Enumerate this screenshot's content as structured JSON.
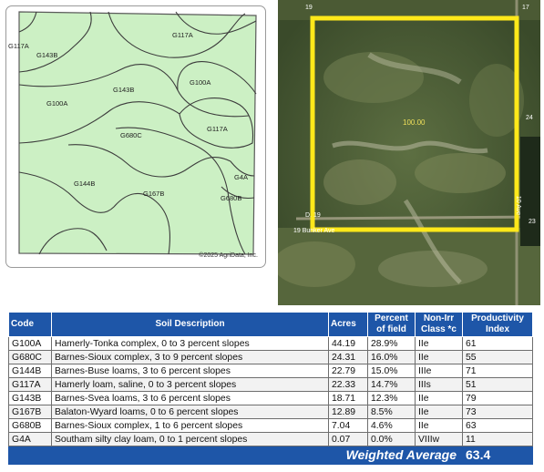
{
  "soil_map": {
    "labels": [
      "G117A",
      "G143B",
      "G117A",
      "G100A",
      "G143B",
      "G100A",
      "G117A",
      "G680C",
      "G4A",
      "G144B",
      "G167B",
      "G680B"
    ],
    "copyright": "©2025 AgriData, Inc."
  },
  "aerial": {
    "field_acres": "100.00",
    "corner_top_left": "19",
    "corner_top_right": "17",
    "bottom_left_text": "D. 19",
    "bottom_road": "19 Bunker Ave",
    "right_road": "10 Ave",
    "right_mark": "24",
    "right_mark_2": "23"
  },
  "table": {
    "headers": {
      "code": "Code",
      "description": "Soil Description",
      "acres": "Acres",
      "percent": "Percent of field",
      "class": "Non-Irr Class *c",
      "productivity": "Productivity Index"
    },
    "rows": [
      {
        "code": "G100A",
        "description": "Hamerly-Tonka complex, 0 to 3 percent slopes",
        "acres": "44.19",
        "percent": "28.9%",
        "class": "IIe",
        "pi": "61"
      },
      {
        "code": "G680C",
        "description": "Barnes-Sioux complex, 3 to 9 percent slopes",
        "acres": "24.31",
        "percent": "16.0%",
        "class": "IIe",
        "pi": "55"
      },
      {
        "code": "G144B",
        "description": "Barnes-Buse loams, 3 to 6 percent slopes",
        "acres": "22.79",
        "percent": "15.0%",
        "class": "IIIe",
        "pi": "71"
      },
      {
        "code": "G117A",
        "description": "Hamerly loam, saline, 0 to 3 percent slopes",
        "acres": "22.33",
        "percent": "14.7%",
        "class": "IIIs",
        "pi": "51"
      },
      {
        "code": "G143B",
        "description": "Barnes-Svea loams, 3 to 6 percent slopes",
        "acres": "18.71",
        "percent": "12.3%",
        "class": "IIe",
        "pi": "79"
      },
      {
        "code": "G167B",
        "description": "Balaton-Wyard loams, 0 to 6 percent slopes",
        "acres": "12.89",
        "percent": "8.5%",
        "class": "IIe",
        "pi": "73"
      },
      {
        "code": "G680B",
        "description": "Barnes-Sioux complex, 1 to 6 percent slopes",
        "acres": "7.04",
        "percent": "4.6%",
        "class": "IIe",
        "pi": "63"
      },
      {
        "code": "G4A",
        "description": "Southam silty clay loam, 0 to 1 percent slopes",
        "acres": "0.07",
        "percent": "0.0%",
        "class": "VIIIw",
        "pi": "11"
      }
    ],
    "weighted_average_label": "Weighted Average",
    "weighted_average_value": "63.4"
  },
  "colors": {
    "header_blue": "#1e56a8",
    "map_green": "#ccf0c4",
    "field_outline": "#ffe81a"
  }
}
